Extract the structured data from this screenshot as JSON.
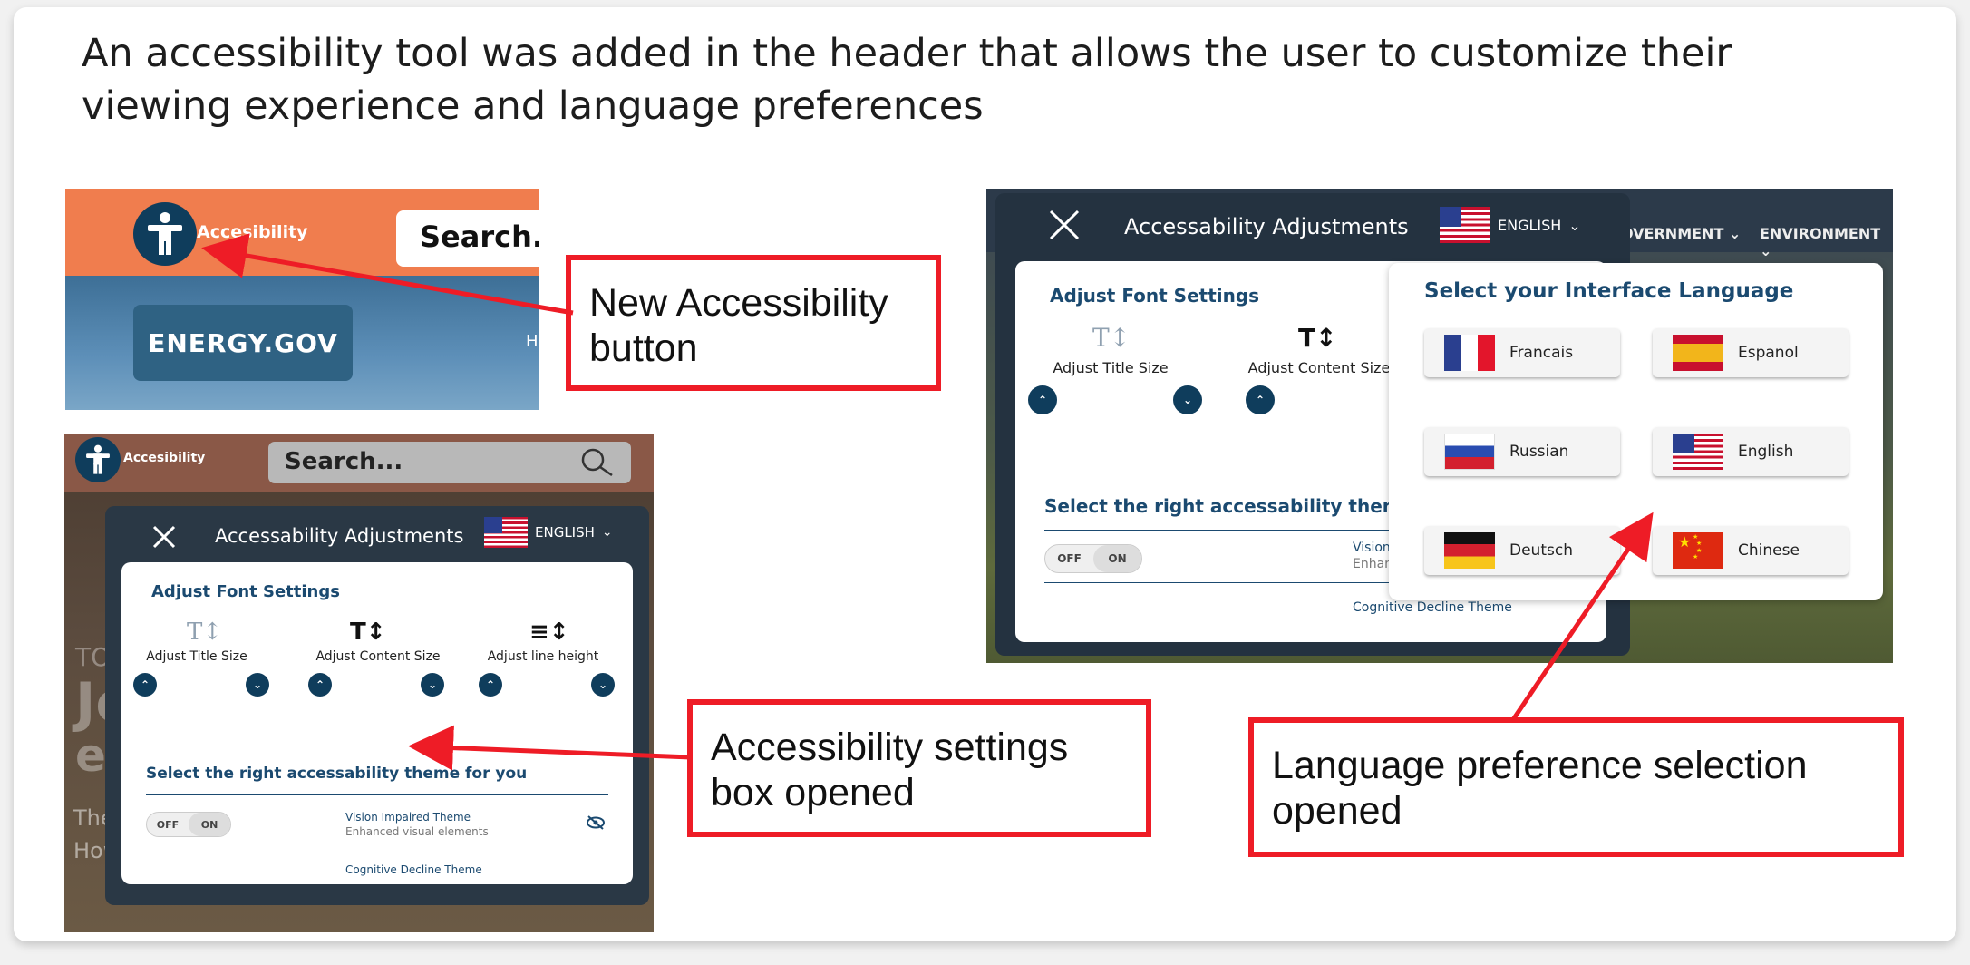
{
  "headline": {
    "line1": "An accessibility tool was added in the header that allows the user to customize their",
    "line2": "viewing experience and language preferences"
  },
  "panel1": {
    "accessibility_label": "Accesibility",
    "search_text": "Search...",
    "site_button": "ENERGY.GOV",
    "nav_partial": "H"
  },
  "callouts": {
    "new_button": [
      "New Accessibility",
      "button"
    ],
    "settings_box": [
      "Accessibility settings",
      "box opened"
    ],
    "language": [
      "Language preference selection",
      "opened"
    ]
  },
  "panel2": {
    "accessibility_label": "Accesibility",
    "search_text": "Search...",
    "modal_title": "Accessability Adjustments",
    "language": "ENGLISH",
    "font_section": "Adjust Font Settings",
    "controls": [
      "Adjust Title Size",
      "Adjust Content Size",
      "Adjust line height"
    ],
    "theme_section": "Select the right accessability theme for you",
    "toggle_off": "OFF",
    "toggle_on": "ON",
    "theme1_name": "Vision Impaired Theme",
    "theme1_desc": "Enhanced visual elements",
    "theme2_name": "Cognitive Decline Theme",
    "bg_text": [
      "TO",
      "Jo",
      "e",
      "The",
      "How"
    ]
  },
  "panel3": {
    "modal_title": "Accessability Adjustments",
    "language": "ENGLISH",
    "nav": [
      "OVERNMENT",
      "ENVIRONMENT"
    ],
    "font_section": "Adjust Font Settings",
    "controls": [
      "Adjust Title Size",
      "Adjust Content Size"
    ],
    "theme_section": "Select the right accessability theme fo",
    "toggle_off": "OFF",
    "toggle_on": "ON",
    "theme1_name": "Vision Impaired The",
    "theme1_desc": "Enhanced visual ele",
    "theme2_name": "Cognitive Decline Theme",
    "lang_title": "Select your Interface Language",
    "languages": [
      "Francais",
      "Espanol",
      "Russian",
      "English",
      "Deutsch",
      "Chinese"
    ]
  },
  "colors": {
    "callout_red": "#ee1c26",
    "header_orange": "#f07d4e",
    "navy": "#0f3d5c",
    "theme_blue": "#1b4a70"
  }
}
